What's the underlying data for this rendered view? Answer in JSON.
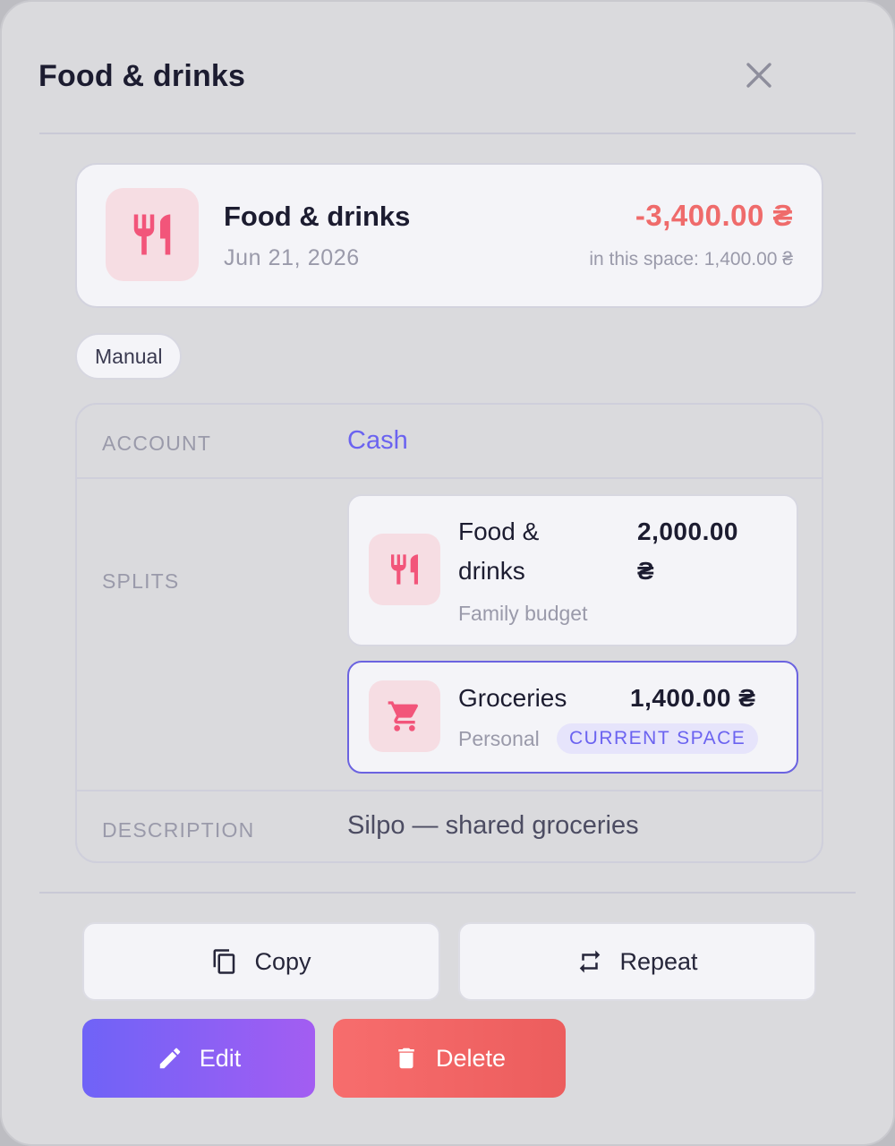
{
  "modal": {
    "title": "Food & drinks",
    "close_icon": "close-icon"
  },
  "summary": {
    "name": "Food & drinks",
    "date": "Jun 21, 2026",
    "amount": "-3,400.00 ₴",
    "space_amount": "in this space: 1,400.00 ₴",
    "icon": "fork-knife-icon",
    "amount_color": "#ef6b6b"
  },
  "chip": {
    "label": "Manual"
  },
  "details": {
    "account_label": "ACCOUNT",
    "account_value": "Cash",
    "splits_label": "SPLITS",
    "description_label": "DESCRIPTION",
    "description_value": "Silpo — shared groceries",
    "splits": [
      {
        "name_line1": "Food &",
        "name_line2": "drinks",
        "amount_line1": "2,000.00",
        "amount_line2": "₴",
        "space": "Family budget",
        "icon": "fork-knife-icon"
      },
      {
        "name": "Groceries",
        "amount": "1,400.00 ₴",
        "space": "Personal",
        "badge": "CURRENT SPACE",
        "icon": "shopping-cart-icon"
      }
    ]
  },
  "actions": {
    "copy": "Copy",
    "repeat": "Repeat",
    "edit": "Edit",
    "delete": "Delete"
  },
  "colors": {
    "accent": "#6b63f0",
    "danger": "#ef6b6b",
    "icon_pink": "#f2557a"
  }
}
